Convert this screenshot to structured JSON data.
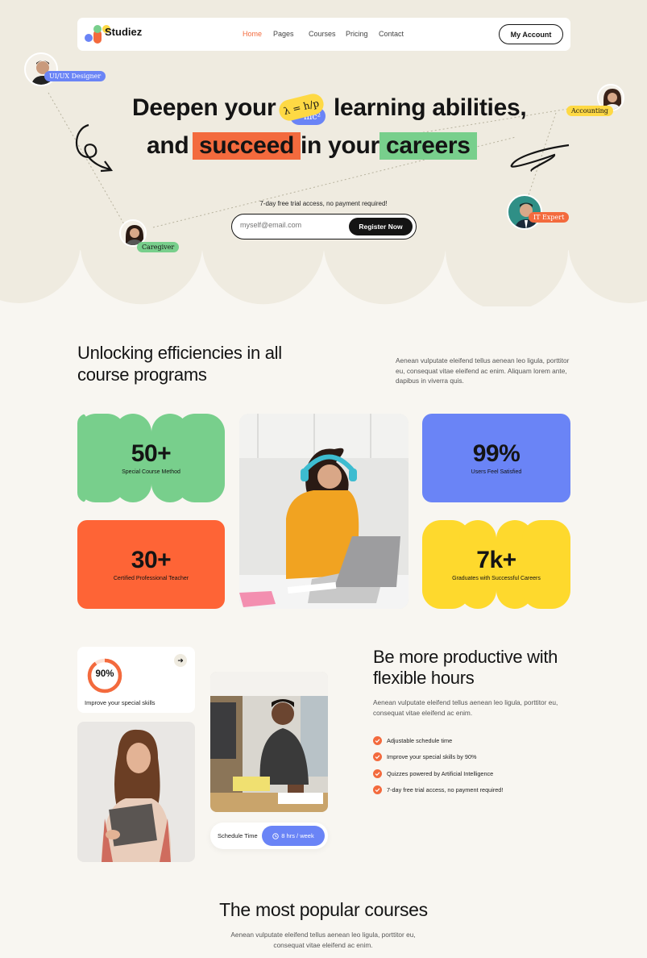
{
  "brand": {
    "name": "Studiez"
  },
  "nav": {
    "items": [
      "Home",
      "Pages",
      "Courses",
      "Pricing",
      "Contact"
    ],
    "active_index": 0,
    "account_label": "My Account"
  },
  "hero": {
    "line1_a": "Deepen your",
    "line1_b": "learning abilities,",
    "line2_a": "and",
    "line2_b": "succeed",
    "line2_c": "in your",
    "line2_d": "careers",
    "formula_1": "λ = h/p",
    "formula_2": "mc²",
    "trial_note": "7-day free trial access, no payment required!",
    "email_placeholder": "myself@email.com",
    "register_label": "Register Now",
    "roles": [
      "UI/UX Designer",
      "Accounting",
      "Caregiver",
      "IT Expert"
    ]
  },
  "stats_section": {
    "title": "Unlocking efficiencies in all course programs",
    "description": "Aenean vulputate eleifend tellus aenean leo ligula, porttitor eu, consequat vitae eleifend ac enim. Aliquam lorem ante, dapibus in viverra quis.",
    "stats": [
      {
        "value": "50+",
        "label": "Special Course Method"
      },
      {
        "value": "30+",
        "label": "Certified Professional Teacher"
      },
      {
        "value": "99%",
        "label": "Users Feel Satisfied"
      },
      {
        "value": "7k+",
        "label": "Graduates with Successful Careers"
      }
    ]
  },
  "productive_section": {
    "skill_percent": "90%",
    "skill_progress": 0.9,
    "skill_caption": "Improve your special skills",
    "schedule_label": "Schedule Time",
    "schedule_value": "8 hrs / week",
    "title": "Be more productive with flexible hours",
    "description": "Aenean vulputate eleifend tellus aenean leo ligula, porttitor eu, consequat vitae eleifend ac enim.",
    "checklist": [
      "Adjustable schedule time",
      "Improve your special skills by 90%",
      "Quizzes powered by Artificial Intelligence",
      "7-day free trial access, no payment required!"
    ]
  },
  "courses_section": {
    "title": "The most popular courses",
    "description": "Aenean vulputate eleifend tellus aenean leo ligula, porttitor eu, consequat vitae eleifend ac enim."
  },
  "colors": {
    "orange": "#f36a3d",
    "green": "#78cf8c",
    "blue": "#6a84f6",
    "yellow": "#fed944",
    "hero_bg": "#efebe0",
    "page_bg": "#f8f6f1",
    "dark": "#141414"
  }
}
